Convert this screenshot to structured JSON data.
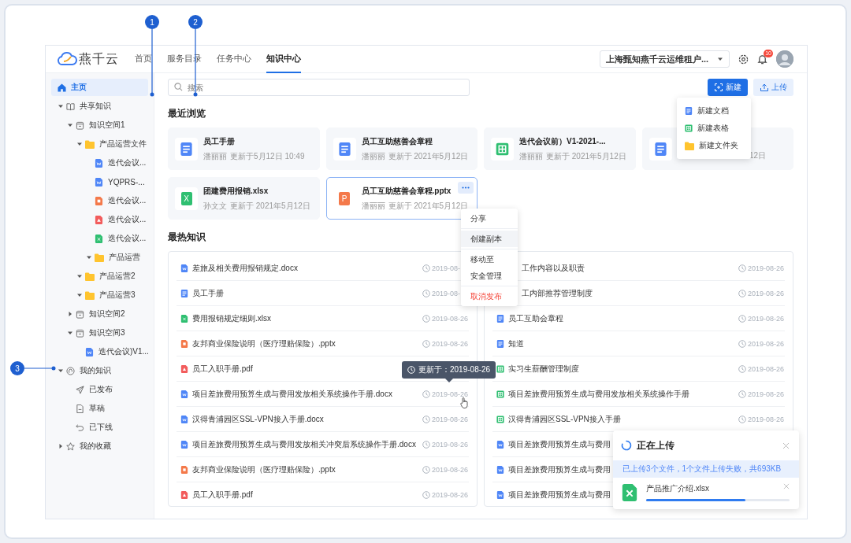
{
  "app_bar": {
    "logo_text": "燕千云",
    "nav": [
      {
        "label": "首页",
        "selected": false
      },
      {
        "label": "服务目录",
        "selected": false
      },
      {
        "label": "任务中心",
        "selected": false
      },
      {
        "label": "知识中心",
        "selected": true
      }
    ],
    "tenant": "上海甄知燕千云运维租户...",
    "notifications": "10"
  },
  "callouts": [
    "1",
    "2",
    "3"
  ],
  "sidebar": {
    "items": [
      {
        "label": "主页",
        "kind": "home",
        "selected": true
      },
      {
        "label": "共享知识",
        "kind": "book",
        "selected": false,
        "expanded": true,
        "children": [
          {
            "label": "知识空间1",
            "kind": "space",
            "selected": false,
            "expanded": true,
            "children": [
              {
                "label": "产品运营文件",
                "kind": "folder",
                "selected": false,
                "expanded": true,
                "children": [
                  {
                    "label": "迭代会议...",
                    "kind": "word",
                    "selected": false
                  },
                  {
                    "label": "YQPRS-...",
                    "kind": "word",
                    "selected": false
                  },
                  {
                    "label": "迭代会议...",
                    "kind": "ppt",
                    "selected": false
                  },
                  {
                    "label": "迭代会议...",
                    "kind": "pdf",
                    "selected": false
                  },
                  {
                    "label": "迭代会议...",
                    "kind": "excel",
                    "selected": false
                  },
                  {
                    "label": "产品运营",
                    "kind": "folder",
                    "selected": false,
                    "expanded": true
                  }
                ]
              },
              {
                "label": "产品运营2",
                "kind": "folder",
                "selected": false,
                "expanded": true
              },
              {
                "label": "产品运营3",
                "kind": "folder",
                "selected": false,
                "expanded": true
              }
            ]
          },
          {
            "label": "知识空间2",
            "kind": "space",
            "selected": false,
            "expanded": false
          },
          {
            "label": "知识空间3",
            "kind": "space",
            "selected": false,
            "expanded": true,
            "children": [
              {
                "label": "迭代会议)V1...",
                "kind": "word",
                "selected": false
              }
            ]
          }
        ]
      },
      {
        "label": "我的知识",
        "kind": "hand",
        "selected": false,
        "expanded": true,
        "children": [
          {
            "label": "已发布",
            "kind": "send",
            "selected": false
          },
          {
            "label": "草稿",
            "kind": "draft",
            "selected": false
          },
          {
            "label": "已下线",
            "kind": "undo",
            "selected": false
          }
        ]
      },
      {
        "label": "我的收藏",
        "kind": "star",
        "selected": false,
        "expanded": false
      }
    ]
  },
  "search": {
    "placeholder": "搜索"
  },
  "actions": [
    {
      "label": "新建",
      "kind": "primary"
    },
    {
      "label": "上传",
      "kind": "secondary"
    }
  ],
  "new_menu": [
    {
      "label": "新建文档",
      "kind": "doc"
    },
    {
      "label": "新建表格",
      "kind": "sheet"
    },
    {
      "label": "新建文件夹",
      "kind": "folder"
    }
  ],
  "recent": {
    "title": "最近浏览",
    "cards": [
      {
        "kind": "doc",
        "title": "员工手册",
        "author": "潘丽丽",
        "updated": "更新于5月12日 10:49",
        "selected": false
      },
      {
        "kind": "doc",
        "title": "员工互助慈善会章程",
        "author": "潘丽丽",
        "updated": "更新于 2021年5月12日",
        "selected": false
      },
      {
        "kind": "sheet",
        "title": "迭代会议前）V1-2021-...",
        "author": "潘丽丽",
        "updated": "更新于 2021年5月12日",
        "selected": false
      },
      {
        "kind": "doc",
        "updated": "12日",
        "selected": false
      },
      {
        "kind": "excel",
        "glyph": "X",
        "title": "团建费用报销.xlsx",
        "author": "孙文文",
        "updated": "更新于 2021年5月12日",
        "selected": false
      },
      {
        "kind": "ppt",
        "glyph": "P",
        "title": "员工互助慈善会章程.pptx",
        "author": "潘丽丽",
        "updated": "更新于 2021年5月12日",
        "selected": true
      }
    ]
  },
  "context_menu": {
    "groups": [
      [
        {
          "label": "分享",
          "kind": "normal",
          "selected": false
        }
      ],
      [
        {
          "label": "创建副本",
          "kind": "normal",
          "selected": true
        }
      ],
      [
        {
          "label": "移动至",
          "kind": "normal",
          "selected": false
        },
        {
          "label": "安全管理",
          "kind": "normal",
          "selected": false
        }
      ],
      [
        {
          "label": "取消发布",
          "kind": "danger",
          "selected": false
        }
      ]
    ]
  },
  "hot": {
    "title": "最热知识",
    "rows": [
      {
        "kind": "word",
        "name": "差旅及相关费用报销规定.docx",
        "date": "2019-08-"
      },
      {
        "kind": "doc",
        "name": "员工手册",
        "date": "2019-08-"
      },
      {
        "kind": "excel",
        "name": "费用报销规定细则.xlsx",
        "date": "2019-08-26"
      },
      {
        "kind": "ppt",
        "name": "友邦商业保险说明（医疗理赔保险）.pptx",
        "date": "2019-08-26"
      },
      {
        "kind": "pdf",
        "name": "员工入职手册.pdf"
      },
      {
        "kind": "word",
        "name": "项目差旅费用预算生成与费用发放相关系统操作手册.docx",
        "date": "2019-08-26"
      },
      {
        "kind": "word",
        "name": "汉得青浦园区SSL-VPN接入手册.docx",
        "date": "2019-08-26"
      },
      {
        "kind": "word",
        "name": "项目差旅费用预算生成与费用发放相关冲突后系统操作手册.docx",
        "date": "2019-08-26"
      },
      {
        "kind": "ppt",
        "name": "友邦商业保险说明（医疗理赔保险）.pptx",
        "date": "2019-08-26"
      },
      {
        "kind": "pdf",
        "name": "员工入职手册.pdf",
        "date": "2019-08-26"
      }
    ]
  },
  "second_list": {
    "rows": [
      {
        "name": "工作内容以及职责",
        "date": "2019-08-26"
      },
      {
        "name": "工内部推荐管理制度",
        "date": "2019-08-26"
      },
      {
        "kind": "doc",
        "name": "员工互助会章程",
        "date": "2019-08-26"
      },
      {
        "kind": "doc",
        "name": "知道",
        "date": "2019-08-26"
      },
      {
        "kind": "sheet",
        "name": "实习生薪酬管理制度",
        "date": "2019-08-26"
      },
      {
        "kind": "sheet",
        "name": "项目差旅费用预算生成与费用发放相关系统操作手册",
        "date": "2019-08-26"
      },
      {
        "kind": "sheet",
        "name": "汉得青浦园区SSL-VPN接入手册",
        "date": "2019-08-26"
      },
      {
        "kind": "word",
        "name": "项目差旅费用预算生成与费用"
      },
      {
        "kind": "word",
        "name": "项目差旅费用预算生成与费用"
      },
      {
        "kind": "word",
        "name": "项目差旅费用预算生成与费用"
      }
    ]
  },
  "tooltip": {
    "text": "更新于：2019-08-26"
  },
  "upload": {
    "title": "正在上传",
    "summary": "已上传3个文件，1个文件上传失败，共693KB",
    "file": {
      "name": "产品推广介绍.xlsx",
      "kind": "excel",
      "level": 0.69
    }
  }
}
